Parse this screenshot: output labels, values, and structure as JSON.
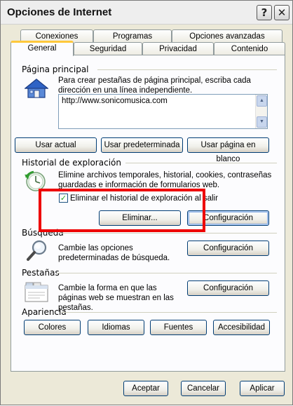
{
  "window": {
    "title": "Opciones de Internet",
    "help_label": "?",
    "close_label": "✕"
  },
  "tabs": {
    "row1": [
      "Conexiones",
      "Programas",
      "Opciones avanzadas"
    ],
    "row2": [
      "General",
      "Seguridad",
      "Privacidad",
      "Contenido"
    ],
    "active": "General"
  },
  "homepage": {
    "group_label": "Página principal",
    "description": "Para crear pestañas de página principal, escriba cada dirección en una línea independiente.",
    "url": "http://www.sonicomusica.com",
    "btn_current": "Usar actual",
    "btn_default": "Usar predeterminada",
    "btn_blank": "Usar página en blanco",
    "icon": "house-icon"
  },
  "history": {
    "group_label": "Historial de exploración",
    "description": "Elimine archivos temporales, historial, cookies, contraseñas guardadas e información de formularios web.",
    "checkbox_label": "Eliminar el historial de exploración al salir",
    "checkbox_checked": true,
    "btn_delete": "Eliminar...",
    "btn_settings": "Configuración",
    "icon": "history-clock-icon"
  },
  "search": {
    "group_label": "Búsqueda",
    "description": "Cambie las opciones predeterminadas de búsqueda.",
    "btn_settings": "Configuración",
    "icon": "magnifier-icon"
  },
  "tabs_section": {
    "group_label": "Pestañas",
    "description": "Cambie la forma en que las páginas web se muestran en las pestañas.",
    "btn_settings": "Configuración",
    "icon": "tabbed-window-icon"
  },
  "appearance": {
    "group_label": "Apariencia",
    "btn_colors": "Colores",
    "btn_languages": "Idiomas",
    "btn_fonts": "Fuentes",
    "btn_accessibility": "Accesibilidad"
  },
  "footer": {
    "btn_ok": "Aceptar",
    "btn_cancel": "Cancelar",
    "btn_apply": "Aplicar"
  },
  "colors": {
    "highlight": "#ee0000",
    "tab_accent": "#ffc83c",
    "button_border": "#003c74"
  }
}
